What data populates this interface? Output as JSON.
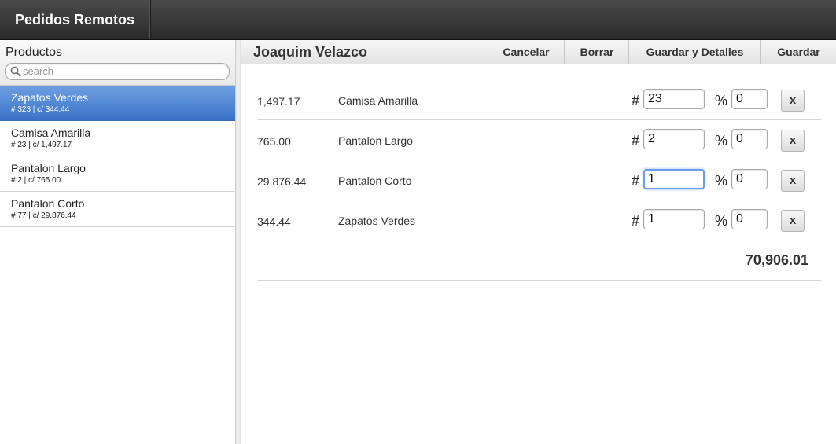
{
  "app": {
    "title": "Pedidos Remotos"
  },
  "sidebar": {
    "title": "Productos",
    "search_placeholder": "search",
    "items": [
      {
        "name": "Zapatos Verdes",
        "meta": "# 323 | c/ 344.44",
        "selected": true
      },
      {
        "name": "Camisa Amarilla",
        "meta": "# 23 | c/ 1,497.17",
        "selected": false
      },
      {
        "name": "Pantalon Largo",
        "meta": "# 2 | c/ 765.00",
        "selected": false
      },
      {
        "name": "Pantalon Corto",
        "meta": "# 77 | c/ 29,876.44",
        "selected": false
      }
    ]
  },
  "main": {
    "customer": "Joaquim Velazco",
    "buttons": {
      "cancel": "Cancelar",
      "delete": "Borrar",
      "save_details": "Guardar y Detalles",
      "save": "Guardar"
    },
    "qty_symbol": "#",
    "discount_symbol": "%",
    "remove_label": "x",
    "lines": [
      {
        "price": "1,497.17",
        "name": "Camisa Amarilla",
        "qty": "23",
        "discount": "0"
      },
      {
        "price": "765.00",
        "name": "Pantalon Largo",
        "qty": "2",
        "discount": "0"
      },
      {
        "price": "29,876.44",
        "name": "Pantalon Corto",
        "qty": "1",
        "discount": "0"
      },
      {
        "price": "344.44",
        "name": "Zapatos Verdes",
        "qty": "1",
        "discount": "0"
      }
    ],
    "total": "70,906.01"
  },
  "colors": {
    "selected_bg": "#3a72c8",
    "focus_ring": "#6a9ee8",
    "topbar": "#2f2f2f"
  }
}
